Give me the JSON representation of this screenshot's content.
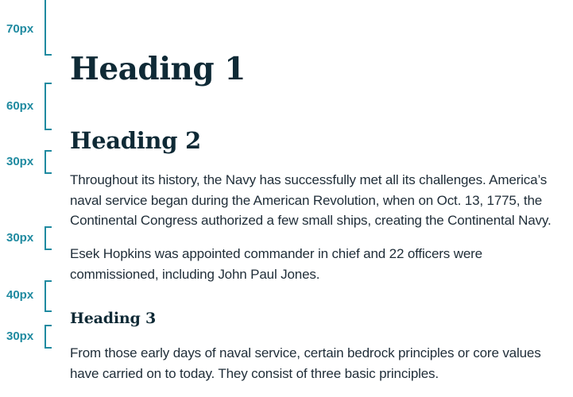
{
  "spacing": {
    "before_h1": "70px",
    "h1_to_h2": "60px",
    "h2_to_p": "30px",
    "p_to_p": "30px",
    "p_to_h3": "40px",
    "h3_to_p": "30px"
  },
  "content": {
    "heading_1": "Heading 1",
    "heading_2": "Heading 2",
    "heading_3": "Heading 3",
    "paragraph_1": "Throughout its history, the Navy has successfully met all its challenges. America’s naval service began during the American Revolution, when on Oct. 13, 1775, the Continental Congress authorized a few small ships, creating the Continental Navy.",
    "paragraph_2": "Esek Hopkins was appointed commander in chief and 22 officers were commissioned, including John Paul Jones.",
    "paragraph_3": "From those early days of naval service, certain bedrock principles or core values have carried on to today. They consist of three basic principles."
  },
  "colors": {
    "annotation": "#1f8aa0",
    "heading": "#0f2a36",
    "body_text": "#1f2d38",
    "background": "#ffffff"
  }
}
